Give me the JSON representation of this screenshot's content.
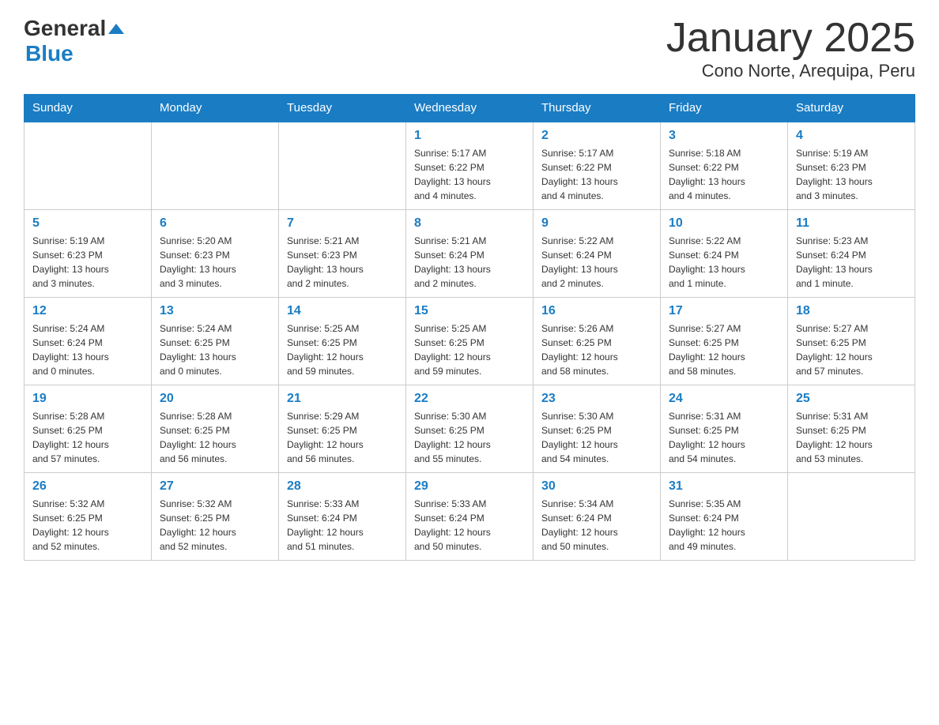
{
  "header": {
    "logo_general": "General",
    "logo_blue": "Blue",
    "title": "January 2025",
    "subtitle": "Cono Norte, Arequipa, Peru"
  },
  "days_of_week": [
    "Sunday",
    "Monday",
    "Tuesday",
    "Wednesday",
    "Thursday",
    "Friday",
    "Saturday"
  ],
  "weeks": [
    [
      {
        "day": "",
        "info": ""
      },
      {
        "day": "",
        "info": ""
      },
      {
        "day": "",
        "info": ""
      },
      {
        "day": "1",
        "info": "Sunrise: 5:17 AM\nSunset: 6:22 PM\nDaylight: 13 hours\nand 4 minutes."
      },
      {
        "day": "2",
        "info": "Sunrise: 5:17 AM\nSunset: 6:22 PM\nDaylight: 13 hours\nand 4 minutes."
      },
      {
        "day": "3",
        "info": "Sunrise: 5:18 AM\nSunset: 6:22 PM\nDaylight: 13 hours\nand 4 minutes."
      },
      {
        "day": "4",
        "info": "Sunrise: 5:19 AM\nSunset: 6:23 PM\nDaylight: 13 hours\nand 3 minutes."
      }
    ],
    [
      {
        "day": "5",
        "info": "Sunrise: 5:19 AM\nSunset: 6:23 PM\nDaylight: 13 hours\nand 3 minutes."
      },
      {
        "day": "6",
        "info": "Sunrise: 5:20 AM\nSunset: 6:23 PM\nDaylight: 13 hours\nand 3 minutes."
      },
      {
        "day": "7",
        "info": "Sunrise: 5:21 AM\nSunset: 6:23 PM\nDaylight: 13 hours\nand 2 minutes."
      },
      {
        "day": "8",
        "info": "Sunrise: 5:21 AM\nSunset: 6:24 PM\nDaylight: 13 hours\nand 2 minutes."
      },
      {
        "day": "9",
        "info": "Sunrise: 5:22 AM\nSunset: 6:24 PM\nDaylight: 13 hours\nand 2 minutes."
      },
      {
        "day": "10",
        "info": "Sunrise: 5:22 AM\nSunset: 6:24 PM\nDaylight: 13 hours\nand 1 minute."
      },
      {
        "day": "11",
        "info": "Sunrise: 5:23 AM\nSunset: 6:24 PM\nDaylight: 13 hours\nand 1 minute."
      }
    ],
    [
      {
        "day": "12",
        "info": "Sunrise: 5:24 AM\nSunset: 6:24 PM\nDaylight: 13 hours\nand 0 minutes."
      },
      {
        "day": "13",
        "info": "Sunrise: 5:24 AM\nSunset: 6:25 PM\nDaylight: 13 hours\nand 0 minutes."
      },
      {
        "day": "14",
        "info": "Sunrise: 5:25 AM\nSunset: 6:25 PM\nDaylight: 12 hours\nand 59 minutes."
      },
      {
        "day": "15",
        "info": "Sunrise: 5:25 AM\nSunset: 6:25 PM\nDaylight: 12 hours\nand 59 minutes."
      },
      {
        "day": "16",
        "info": "Sunrise: 5:26 AM\nSunset: 6:25 PM\nDaylight: 12 hours\nand 58 minutes."
      },
      {
        "day": "17",
        "info": "Sunrise: 5:27 AM\nSunset: 6:25 PM\nDaylight: 12 hours\nand 58 minutes."
      },
      {
        "day": "18",
        "info": "Sunrise: 5:27 AM\nSunset: 6:25 PM\nDaylight: 12 hours\nand 57 minutes."
      }
    ],
    [
      {
        "day": "19",
        "info": "Sunrise: 5:28 AM\nSunset: 6:25 PM\nDaylight: 12 hours\nand 57 minutes."
      },
      {
        "day": "20",
        "info": "Sunrise: 5:28 AM\nSunset: 6:25 PM\nDaylight: 12 hours\nand 56 minutes."
      },
      {
        "day": "21",
        "info": "Sunrise: 5:29 AM\nSunset: 6:25 PM\nDaylight: 12 hours\nand 56 minutes."
      },
      {
        "day": "22",
        "info": "Sunrise: 5:30 AM\nSunset: 6:25 PM\nDaylight: 12 hours\nand 55 minutes."
      },
      {
        "day": "23",
        "info": "Sunrise: 5:30 AM\nSunset: 6:25 PM\nDaylight: 12 hours\nand 54 minutes."
      },
      {
        "day": "24",
        "info": "Sunrise: 5:31 AM\nSunset: 6:25 PM\nDaylight: 12 hours\nand 54 minutes."
      },
      {
        "day": "25",
        "info": "Sunrise: 5:31 AM\nSunset: 6:25 PM\nDaylight: 12 hours\nand 53 minutes."
      }
    ],
    [
      {
        "day": "26",
        "info": "Sunrise: 5:32 AM\nSunset: 6:25 PM\nDaylight: 12 hours\nand 52 minutes."
      },
      {
        "day": "27",
        "info": "Sunrise: 5:32 AM\nSunset: 6:25 PM\nDaylight: 12 hours\nand 52 minutes."
      },
      {
        "day": "28",
        "info": "Sunrise: 5:33 AM\nSunset: 6:24 PM\nDaylight: 12 hours\nand 51 minutes."
      },
      {
        "day": "29",
        "info": "Sunrise: 5:33 AM\nSunset: 6:24 PM\nDaylight: 12 hours\nand 50 minutes."
      },
      {
        "day": "30",
        "info": "Sunrise: 5:34 AM\nSunset: 6:24 PM\nDaylight: 12 hours\nand 50 minutes."
      },
      {
        "day": "31",
        "info": "Sunrise: 5:35 AM\nSunset: 6:24 PM\nDaylight: 12 hours\nand 49 minutes."
      },
      {
        "day": "",
        "info": ""
      }
    ]
  ]
}
